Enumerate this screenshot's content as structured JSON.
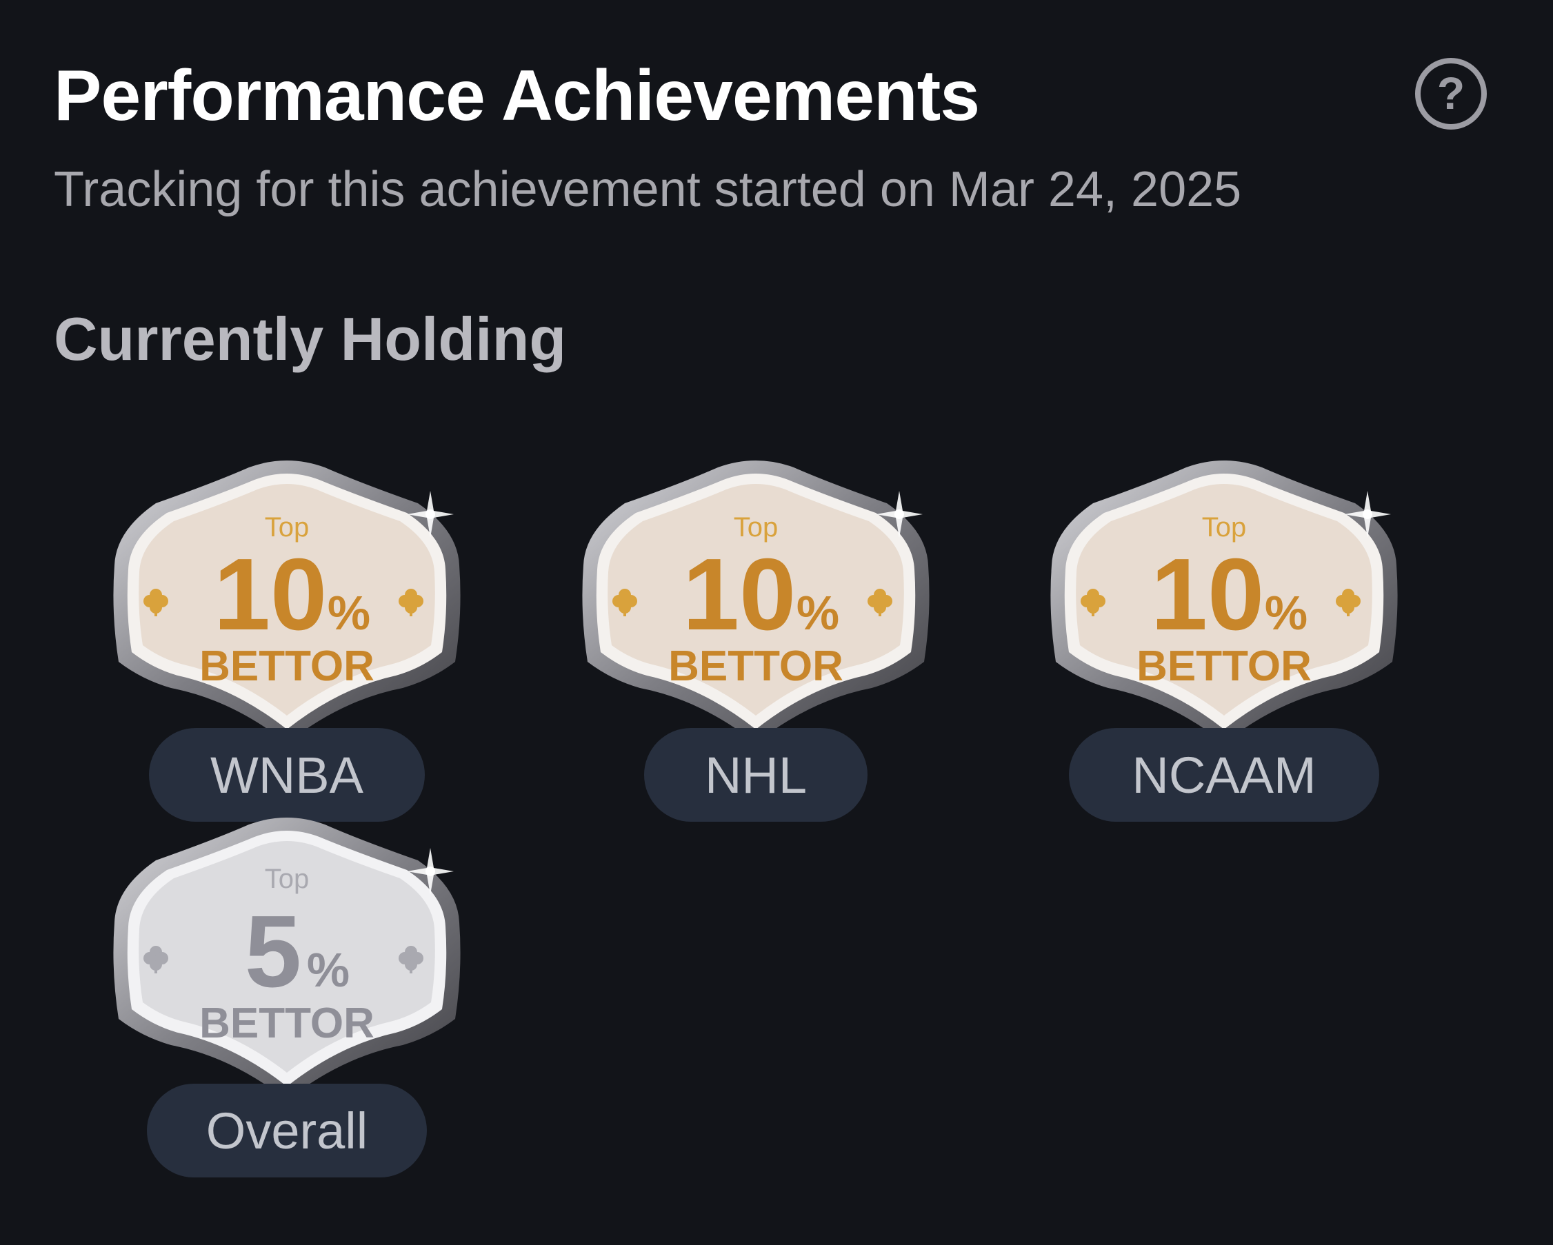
{
  "header": {
    "title": "Performance Achievements",
    "help_icon": "question-circle-icon",
    "help_symbol": "?",
    "subtitle": "Tracking for this achievement started on Mar 24, 2025"
  },
  "section": {
    "title": "Currently Holding"
  },
  "badges": [
    {
      "top_label": "Top",
      "number": "10",
      "percent": "%",
      "caption": "BETTOR",
      "league": "WNBA",
      "tier": "gold"
    },
    {
      "top_label": "Top",
      "number": "10",
      "percent": "%",
      "caption": "BETTOR",
      "league": "NHL",
      "tier": "gold"
    },
    {
      "top_label": "Top",
      "number": "10",
      "percent": "%",
      "caption": "BETTOR",
      "league": "NCAAM",
      "tier": "gold"
    },
    {
      "top_label": "Top",
      "number": "5",
      "percent": "%",
      "caption": "BETTOR",
      "league": "Overall",
      "tier": "silver"
    }
  ],
  "colors": {
    "background": "#121419",
    "pill": "#272f3e",
    "gold_text": "#c8862a",
    "silver_text": "#8f8f98",
    "gold_face": "#e8dcd1",
    "silver_face": "#dcdcdf"
  }
}
